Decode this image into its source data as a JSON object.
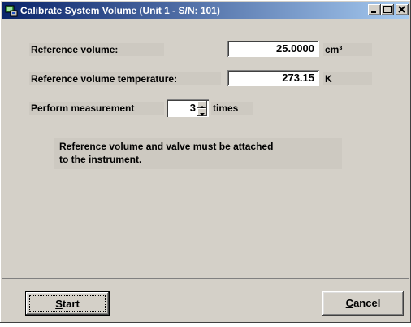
{
  "window": {
    "title": "Calibrate System Volume (Unit 1 - S/N: 101)"
  },
  "form": {
    "ref_volume_label": "Reference volume:",
    "ref_volume_value": "25.0000",
    "ref_volume_unit": "cm³",
    "ref_temp_label": "Reference volume temperature:",
    "ref_temp_value": "273.15",
    "ref_temp_unit": "K",
    "perform_label": "Perform measurement",
    "perform_count": "3",
    "perform_suffix": "times"
  },
  "note": {
    "line1": "Reference volume and valve must be attached",
    "line2": "to the instrument."
  },
  "buttons": {
    "start_mnemonic": "S",
    "start_rest": "tart",
    "cancel_mnemonic": "C",
    "cancel_rest": "ancel"
  },
  "icons": {
    "app": "system-volume-app-icon",
    "minimize": "minimize-icon",
    "maximize": "maximize-icon",
    "close": "close-icon",
    "spin_up": "arrow-up-icon",
    "spin_down": "arrow-down-icon"
  }
}
